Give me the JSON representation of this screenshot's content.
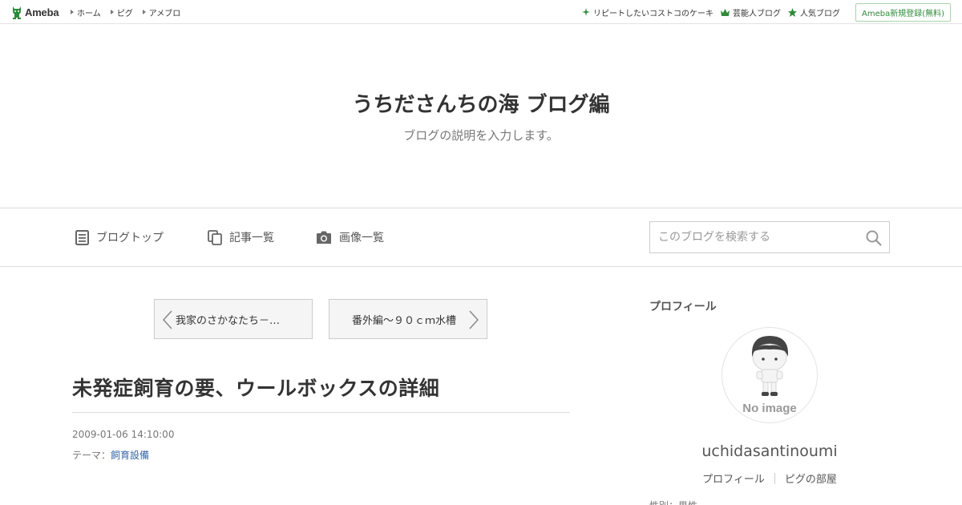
{
  "topbar": {
    "logo_text": "Ameba",
    "nav": [
      "ホーム",
      "ピグ",
      "アメブロ"
    ],
    "right_links": [
      {
        "label": "リピートしたいコストコのケーキ",
        "icon": "sparkle-icon"
      },
      {
        "label": "芸能人ブログ",
        "icon": "crown-icon"
      },
      {
        "label": "人気ブログ",
        "icon": "star-icon"
      }
    ],
    "signup_label": "Ameba新規登録(無料)",
    "accent_color": "#2e8b3a"
  },
  "header": {
    "title": "うちださんちの海 ブログ編",
    "description": "ブログの説明を入力します。"
  },
  "navbar": {
    "blog_top": "ブログトップ",
    "entries": "記事一覧",
    "images": "画像一覧",
    "search_placeholder": "このブログを検索する"
  },
  "article": {
    "prev_label": "我家のさかなたち－…",
    "next_label": "番外編～９０ｃｍ水槽",
    "title": "未発症飼育の要、ウールボックスの詳細",
    "date": "2009-01-06 14:10:00",
    "theme_prefix": "テーマ：",
    "theme": "飼育設備"
  },
  "sidebar": {
    "heading": "プロフィール",
    "avatar_caption": "No image",
    "username": "uchidasantinoumi",
    "links": [
      "プロフィール",
      "ピグの部屋"
    ],
    "cutoff_text": "性別：男性"
  }
}
